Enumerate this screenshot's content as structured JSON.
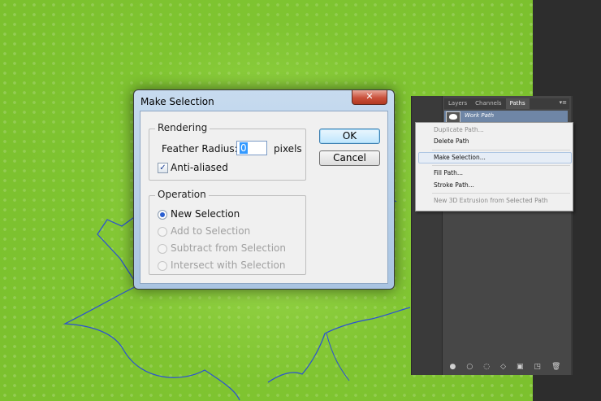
{
  "dialog": {
    "title": "Make Selection",
    "close_glyph": "✕",
    "rendering": {
      "legend": "Rendering",
      "feather_label": "Feather Radius:",
      "feather_value": "0",
      "feather_unit": "pixels",
      "antialias_label": "Anti-aliased",
      "antialias_checked": true
    },
    "operation": {
      "legend": "Operation",
      "options": [
        {
          "label": "New Selection",
          "selected": true,
          "enabled": true
        },
        {
          "label": "Add to Selection",
          "selected": false,
          "enabled": false
        },
        {
          "label": "Subtract from Selection",
          "selected": false,
          "enabled": false
        },
        {
          "label": "Intersect with Selection",
          "selected": false,
          "enabled": false
        }
      ]
    },
    "buttons": {
      "ok": "OK",
      "cancel": "Cancel"
    }
  },
  "panel": {
    "tabs": [
      "Layers",
      "Channels",
      "Paths"
    ],
    "active_tab": "Paths",
    "menu_glyph": "▾≡",
    "path_name": "Work Path",
    "bottom_icons": [
      "fill-path-icon",
      "stroke-path-icon",
      "load-selection-icon",
      "make-work-path-icon",
      "add-mask-icon",
      "new-path-icon",
      "delete-path-icon"
    ],
    "bottom_glyphs": [
      "●",
      "○",
      "◌",
      "◇",
      "▣",
      "◳",
      "🗑"
    ]
  },
  "context_menu": {
    "items": [
      {
        "label": "Duplicate Path...",
        "enabled": false
      },
      {
        "label": "Delete Path",
        "enabled": true
      },
      {
        "label": "Make Selection...",
        "enabled": true,
        "highlighted": true
      },
      {
        "label": "Fill Path...",
        "enabled": true
      },
      {
        "label": "Stroke Path...",
        "enabled": true
      },
      {
        "label": "New 3D Extrusion from Selected Path",
        "enabled": false
      }
    ]
  },
  "colors": {
    "canvas_green": "#7cc12e",
    "path_stroke": "#2a4fd6",
    "selection_blue": "#3399ff"
  }
}
